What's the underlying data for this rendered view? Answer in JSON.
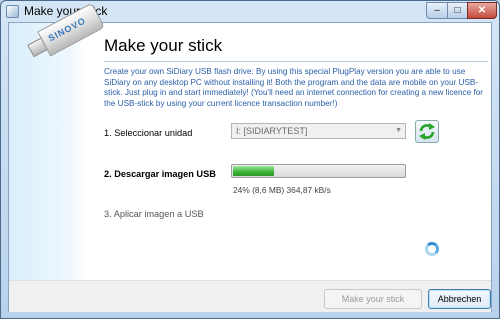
{
  "window": {
    "title": "Make your stick"
  },
  "title_controls": {
    "minimize": "–",
    "maximize": "□",
    "close": "✕"
  },
  "sidebar": {
    "brand": "SINOVO"
  },
  "main": {
    "heading": "Make your stick",
    "intro": "Create your own SiDiary USB flash drive: By using this special PlugPlay version you are able to use SiDiary on any desktop PC without installing it! Both the program and the data are mobile on your USB-stick. Just plug in and start immediately! (You'll need an internet connection for creating a new licence for the USB-stick by using your current licence transaction number!)",
    "steps": [
      {
        "label": "1. Seleccionar unidad",
        "state": "done"
      },
      {
        "label": "2. Descargar imagen USB",
        "state": "active"
      },
      {
        "label": "3. Aplicar imagen a USB",
        "state": "pending"
      }
    ],
    "drive": {
      "selected": "I:  [SIDIARYTEST]"
    },
    "download": {
      "progress": 0.24,
      "status_text": "24% (8,6 MB) 364,87  kB/s"
    }
  },
  "footer": {
    "make_button": "Make your stick",
    "cancel_button": "Abbrechen"
  },
  "colors": {
    "intro_text": "#2a5fa8",
    "progress_fill": "#39b236",
    "refresh_arrows": "#2aa52a"
  },
  "icons": {
    "refresh": "refresh-icon",
    "spinner": "loading-spinner-icon",
    "usb": "usb-stick-icon"
  }
}
